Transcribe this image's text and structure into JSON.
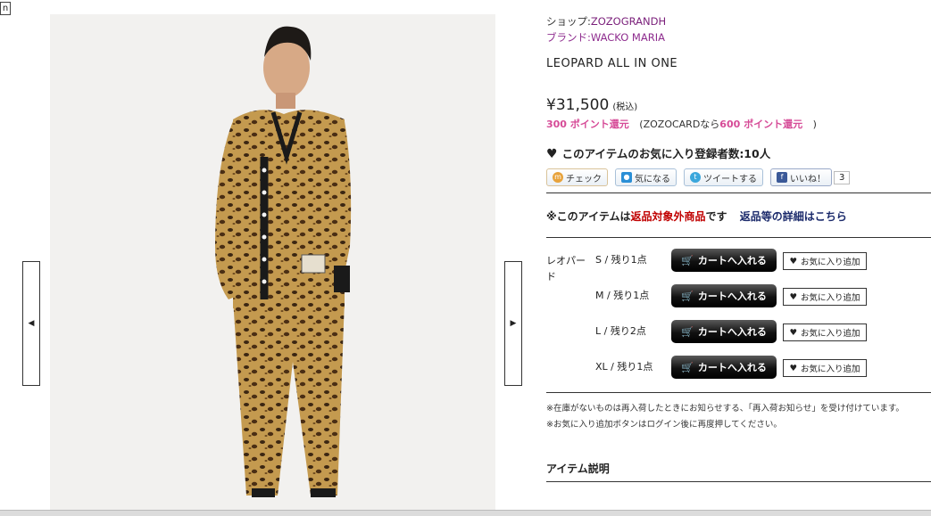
{
  "corner": {
    "label": "n"
  },
  "nav": {
    "prev_glyph": "◀",
    "next_glyph": "▶"
  },
  "shop": {
    "prefix": "ショップ:",
    "name": "ZOZOGRANDH"
  },
  "brand": {
    "prefix": "ブランド:",
    "name": "WACKO MARIA"
  },
  "product": {
    "title": "LEOPARD ALL IN ONE",
    "price": "¥31,500",
    "tax": "(税込)"
  },
  "points": {
    "base": "300 ポイント還元",
    "card_prefix": "(ZOZOCARDなら",
    "card_points": "600 ポイント還元",
    "card_suffix": ")"
  },
  "favorites": {
    "heart": "♥",
    "text": "このアイテムのお気に入り登録者数:10人"
  },
  "social": {
    "check": "チェック",
    "kininaru": "気になる",
    "tweet": "ツイートする",
    "like": "いいね！",
    "like_count": "3",
    "colors": {
      "check": "#e8a33c",
      "kininaru": "#2a8fd6",
      "tweet": "#3ba7dc",
      "like": "#3b5998"
    }
  },
  "returns": {
    "prefix": "※このアイテムは",
    "highlight": "返品対象外商品",
    "suffix": "です",
    "link": "返品等の詳細はこちら"
  },
  "variants": {
    "color": "レオパード",
    "sizes": [
      {
        "label": "S / 残り1点"
      },
      {
        "label": "M / 残り1点"
      },
      {
        "label": "L / 残り2点"
      },
      {
        "label": "XL / 残り1点"
      }
    ],
    "cart_label": "カートへ入れる",
    "fav_label": "お気に入り追加"
  },
  "notes": [
    "※在庫がないものは再入荷したときにお知らせする、「再入荷お知らせ」を受け付けています。",
    "※お気に入り追加ボタンはログイン後に再度押してください。"
  ],
  "description": {
    "heading": "アイテム説明"
  },
  "colors": {
    "price_pink": "#d64b97",
    "return_red": "#c00000",
    "link_navy": "#1b2a6b",
    "brand_purple": "#8e2c8e"
  }
}
